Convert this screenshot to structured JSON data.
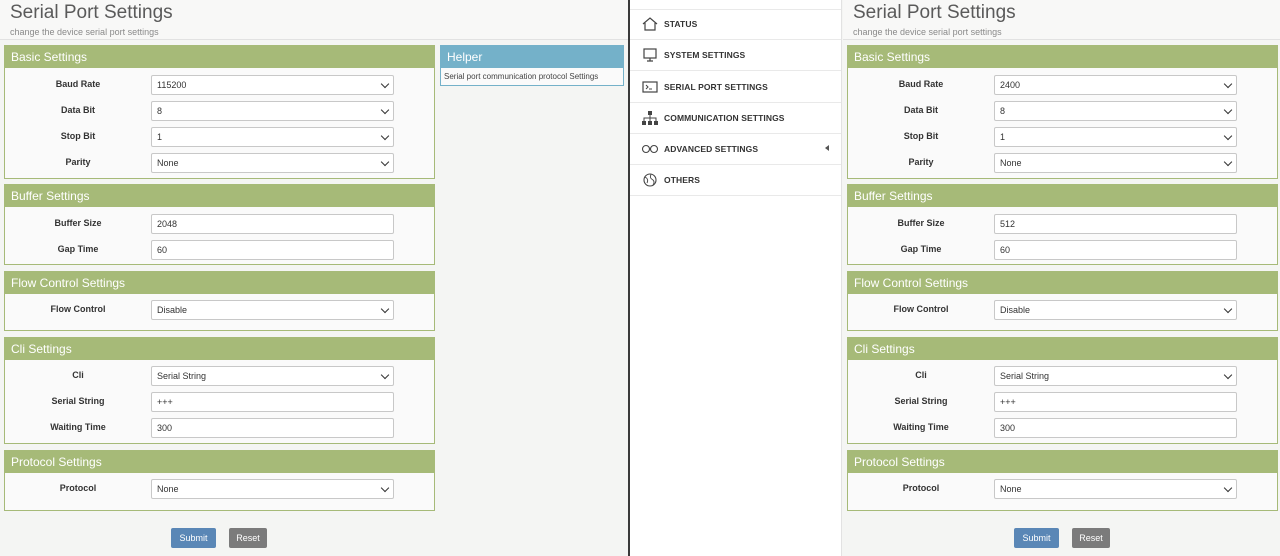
{
  "left": {
    "title": "Serial Port Settings",
    "subtitle": "change the device serial port settings",
    "basic": {
      "title": "Basic Settings",
      "baud_label": "Baud Rate",
      "baud": "115200",
      "databit_label": "Data Bit",
      "databit": "8",
      "stopbit_label": "Stop Bit",
      "stopbit": "1",
      "parity_label": "Parity",
      "parity": "None"
    },
    "buffer": {
      "title": "Buffer Settings",
      "size_label": "Buffer Size",
      "size": "2048",
      "gap_label": "Gap Time",
      "gap": "60"
    },
    "flow": {
      "title": "Flow Control Settings",
      "label": "Flow Control",
      "value": "Disable"
    },
    "cli": {
      "title": "Cli Settings",
      "cli_label": "Cli",
      "cli": "Serial String",
      "string_label": "Serial String",
      "string": "+++",
      "wait_label": "Waiting Time",
      "wait": "300"
    },
    "protocol": {
      "title": "Protocol Settings",
      "label": "Protocol",
      "value": "None"
    },
    "submit": "Submit",
    "reset": "Reset"
  },
  "helper": {
    "title": "Helper",
    "text": "Serial port communication protocol Settings"
  },
  "nav": {
    "items": [
      {
        "label": "STATUS",
        "icon": "home-icon"
      },
      {
        "label": "SYSTEM SETTINGS",
        "icon": "monitor-icon"
      },
      {
        "label": "SERIAL PORT SETTINGS",
        "icon": "terminal-icon"
      },
      {
        "label": "COMMUNICATION SETTINGS",
        "icon": "sitemap-icon"
      },
      {
        "label": "ADVANCED SETTINGS",
        "icon": "infinity-icon"
      },
      {
        "label": "OTHERS",
        "icon": "globe-icon"
      }
    ]
  },
  "right": {
    "title": "Serial Port Settings",
    "subtitle": "change the device serial port settings",
    "basic": {
      "title": "Basic Settings",
      "baud_label": "Baud Rate",
      "baud": "2400",
      "databit_label": "Data Bit",
      "databit": "8",
      "stopbit_label": "Stop Bit",
      "stopbit": "1",
      "parity_label": "Parity",
      "parity": "None"
    },
    "buffer": {
      "title": "Buffer Settings",
      "size_label": "Buffer Size",
      "size": "512",
      "gap_label": "Gap Time",
      "gap": "60"
    },
    "flow": {
      "title": "Flow Control Settings",
      "label": "Flow Control",
      "value": "Disable"
    },
    "cli": {
      "title": "Cli Settings",
      "cli_label": "Cli",
      "cli": "Serial String",
      "string_label": "Serial String",
      "string": "+++",
      "wait_label": "Waiting Time",
      "wait": "300"
    },
    "protocol": {
      "title": "Protocol Settings",
      "label": "Protocol",
      "value": "None"
    },
    "submit": "Submit",
    "reset": "Reset"
  }
}
